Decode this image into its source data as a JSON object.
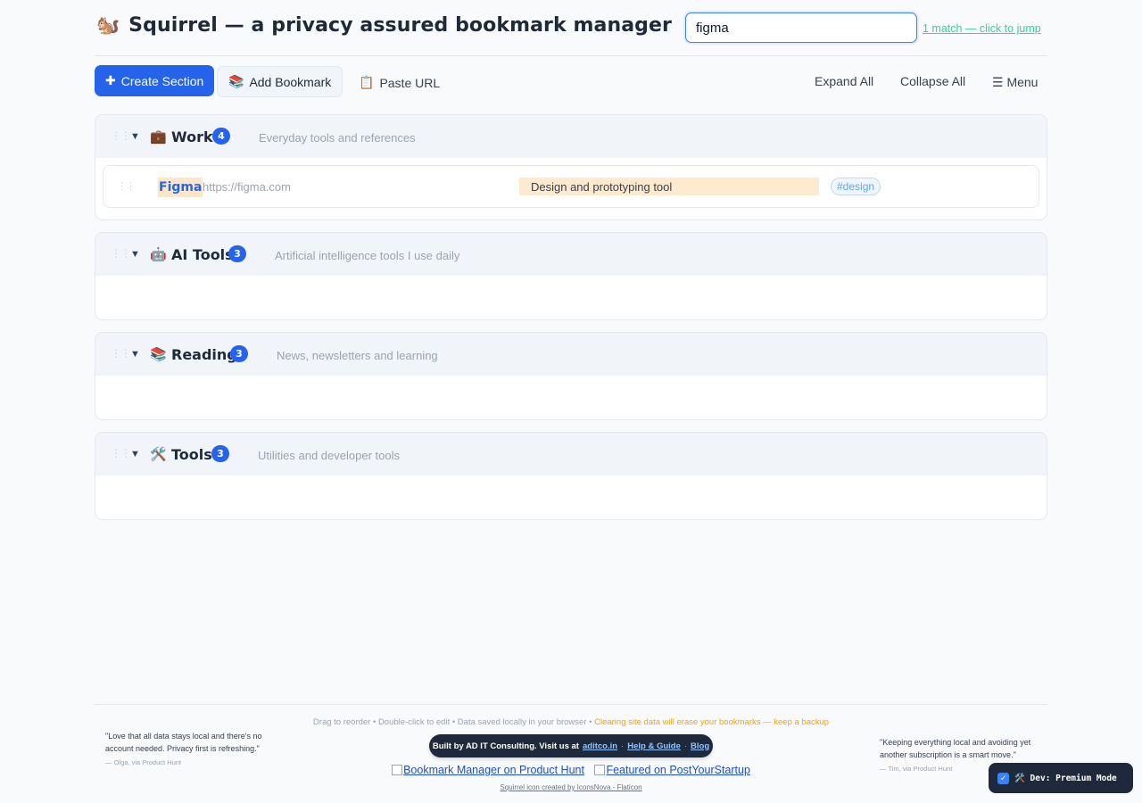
{
  "header": {
    "logo_icon": "🐿️",
    "title": "Squirrel — a privacy assured bookmark manager",
    "search_value": "figma",
    "match_text": "1 match — click to jump"
  },
  "toolbar": {
    "create_section": "Create Section",
    "create_icon": "✚",
    "add_bookmark": "Add Bookmark",
    "add_bookmark_icon": "📚",
    "paste_url": "Paste URL",
    "paste_icon": "📋",
    "expand_all": "Expand All",
    "collapse_all": "Collapse All",
    "menu": "☰ Menu"
  },
  "sections": [
    {
      "icon": "💼",
      "name": "Work",
      "count": "4",
      "description": "Everyday tools and references",
      "bookmarks": [
        {
          "name": "Figma",
          "url": "https://figma.com",
          "description": "Design and prototyping tool",
          "tag": "#design"
        }
      ]
    },
    {
      "icon": "🤖",
      "name": "AI Tools",
      "count": "3",
      "description": "Artificial intelligence tools I use daily",
      "bookmarks": []
    },
    {
      "icon": "📚",
      "name": "Reading",
      "count": "3",
      "description": "News, newsletters and learning",
      "bookmarks": []
    },
    {
      "icon": "🛠️",
      "name": "Tools",
      "count": "3",
      "description": "Utilities and developer tools",
      "bookmarks": []
    }
  ],
  "footer": {
    "hint": "Drag to reorder • Double-click to edit • Data saved locally in your browser • ",
    "warning": "Clearing site data will erase your bookmarks — keep a backup",
    "built_prefix": "Built by AD IT Consulting. Visit us at",
    "site_link": "aditco.in",
    "help_link": "Help & Guide",
    "blog_link": "Blog",
    "sep": "·",
    "ph_link_1": "Bookmark Manager on Product Hunt",
    "ph_link_2": "Featured on PostYourStartup",
    "credit": "Squirrel icon created by IconsNova - Flaticon",
    "quote_left": "\"Love that all data stays local and there's no account needed. Privacy first is refreshing.\"",
    "quote_left_by": "— Olga, via Product Hunt",
    "quote_right": "\"Keeping everything local and avoiding yet another subscription is a smart move.\"",
    "quote_right_by": "— Tim, via Product Hunt"
  },
  "dev_toggle": {
    "label": "🛠️ Dev: Premium Mode",
    "checkmark": "✓",
    "checked": true
  }
}
